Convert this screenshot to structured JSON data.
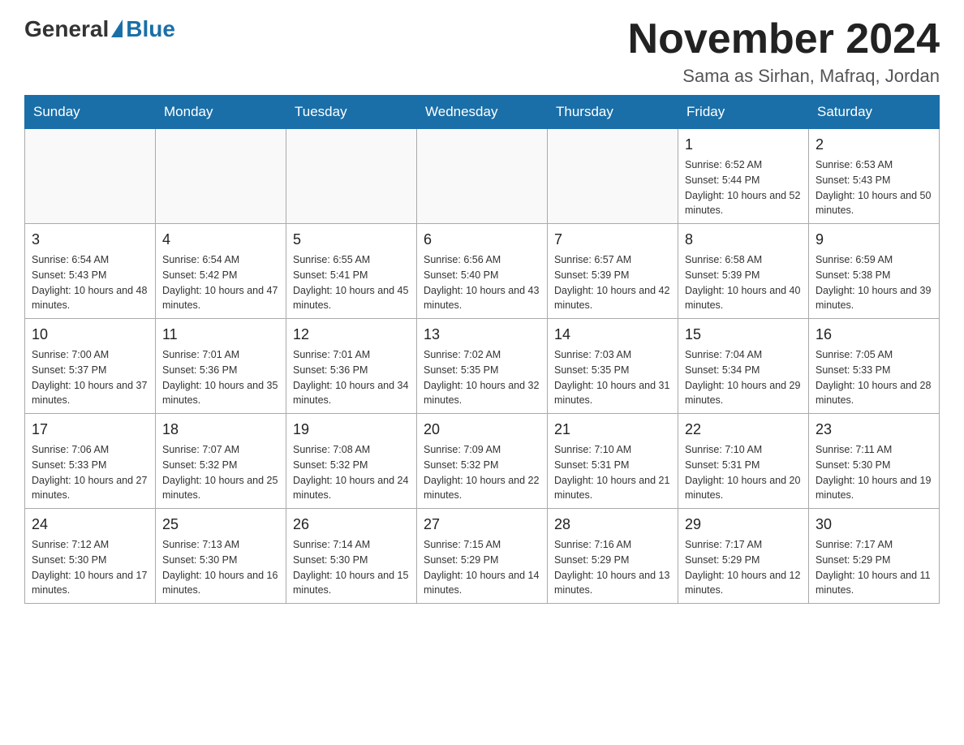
{
  "header": {
    "logo": {
      "general": "General",
      "blue": "Blue"
    },
    "title": "November 2024",
    "location": "Sama as Sirhan, Mafraq, Jordan"
  },
  "days_of_week": [
    "Sunday",
    "Monday",
    "Tuesday",
    "Wednesday",
    "Thursday",
    "Friday",
    "Saturday"
  ],
  "weeks": [
    [
      {
        "day": "",
        "sunrise": "",
        "sunset": "",
        "daylight": ""
      },
      {
        "day": "",
        "sunrise": "",
        "sunset": "",
        "daylight": ""
      },
      {
        "day": "",
        "sunrise": "",
        "sunset": "",
        "daylight": ""
      },
      {
        "day": "",
        "sunrise": "",
        "sunset": "",
        "daylight": ""
      },
      {
        "day": "",
        "sunrise": "",
        "sunset": "",
        "daylight": ""
      },
      {
        "day": "1",
        "sunrise": "Sunrise: 6:52 AM",
        "sunset": "Sunset: 5:44 PM",
        "daylight": "Daylight: 10 hours and 52 minutes."
      },
      {
        "day": "2",
        "sunrise": "Sunrise: 6:53 AM",
        "sunset": "Sunset: 5:43 PM",
        "daylight": "Daylight: 10 hours and 50 minutes."
      }
    ],
    [
      {
        "day": "3",
        "sunrise": "Sunrise: 6:54 AM",
        "sunset": "Sunset: 5:43 PM",
        "daylight": "Daylight: 10 hours and 48 minutes."
      },
      {
        "day": "4",
        "sunrise": "Sunrise: 6:54 AM",
        "sunset": "Sunset: 5:42 PM",
        "daylight": "Daylight: 10 hours and 47 minutes."
      },
      {
        "day": "5",
        "sunrise": "Sunrise: 6:55 AM",
        "sunset": "Sunset: 5:41 PM",
        "daylight": "Daylight: 10 hours and 45 minutes."
      },
      {
        "day": "6",
        "sunrise": "Sunrise: 6:56 AM",
        "sunset": "Sunset: 5:40 PM",
        "daylight": "Daylight: 10 hours and 43 minutes."
      },
      {
        "day": "7",
        "sunrise": "Sunrise: 6:57 AM",
        "sunset": "Sunset: 5:39 PM",
        "daylight": "Daylight: 10 hours and 42 minutes."
      },
      {
        "day": "8",
        "sunrise": "Sunrise: 6:58 AM",
        "sunset": "Sunset: 5:39 PM",
        "daylight": "Daylight: 10 hours and 40 minutes."
      },
      {
        "day": "9",
        "sunrise": "Sunrise: 6:59 AM",
        "sunset": "Sunset: 5:38 PM",
        "daylight": "Daylight: 10 hours and 39 minutes."
      }
    ],
    [
      {
        "day": "10",
        "sunrise": "Sunrise: 7:00 AM",
        "sunset": "Sunset: 5:37 PM",
        "daylight": "Daylight: 10 hours and 37 minutes."
      },
      {
        "day": "11",
        "sunrise": "Sunrise: 7:01 AM",
        "sunset": "Sunset: 5:36 PM",
        "daylight": "Daylight: 10 hours and 35 minutes."
      },
      {
        "day": "12",
        "sunrise": "Sunrise: 7:01 AM",
        "sunset": "Sunset: 5:36 PM",
        "daylight": "Daylight: 10 hours and 34 minutes."
      },
      {
        "day": "13",
        "sunrise": "Sunrise: 7:02 AM",
        "sunset": "Sunset: 5:35 PM",
        "daylight": "Daylight: 10 hours and 32 minutes."
      },
      {
        "day": "14",
        "sunrise": "Sunrise: 7:03 AM",
        "sunset": "Sunset: 5:35 PM",
        "daylight": "Daylight: 10 hours and 31 minutes."
      },
      {
        "day": "15",
        "sunrise": "Sunrise: 7:04 AM",
        "sunset": "Sunset: 5:34 PM",
        "daylight": "Daylight: 10 hours and 29 minutes."
      },
      {
        "day": "16",
        "sunrise": "Sunrise: 7:05 AM",
        "sunset": "Sunset: 5:33 PM",
        "daylight": "Daylight: 10 hours and 28 minutes."
      }
    ],
    [
      {
        "day": "17",
        "sunrise": "Sunrise: 7:06 AM",
        "sunset": "Sunset: 5:33 PM",
        "daylight": "Daylight: 10 hours and 27 minutes."
      },
      {
        "day": "18",
        "sunrise": "Sunrise: 7:07 AM",
        "sunset": "Sunset: 5:32 PM",
        "daylight": "Daylight: 10 hours and 25 minutes."
      },
      {
        "day": "19",
        "sunrise": "Sunrise: 7:08 AM",
        "sunset": "Sunset: 5:32 PM",
        "daylight": "Daylight: 10 hours and 24 minutes."
      },
      {
        "day": "20",
        "sunrise": "Sunrise: 7:09 AM",
        "sunset": "Sunset: 5:32 PM",
        "daylight": "Daylight: 10 hours and 22 minutes."
      },
      {
        "day": "21",
        "sunrise": "Sunrise: 7:10 AM",
        "sunset": "Sunset: 5:31 PM",
        "daylight": "Daylight: 10 hours and 21 minutes."
      },
      {
        "day": "22",
        "sunrise": "Sunrise: 7:10 AM",
        "sunset": "Sunset: 5:31 PM",
        "daylight": "Daylight: 10 hours and 20 minutes."
      },
      {
        "day": "23",
        "sunrise": "Sunrise: 7:11 AM",
        "sunset": "Sunset: 5:30 PM",
        "daylight": "Daylight: 10 hours and 19 minutes."
      }
    ],
    [
      {
        "day": "24",
        "sunrise": "Sunrise: 7:12 AM",
        "sunset": "Sunset: 5:30 PM",
        "daylight": "Daylight: 10 hours and 17 minutes."
      },
      {
        "day": "25",
        "sunrise": "Sunrise: 7:13 AM",
        "sunset": "Sunset: 5:30 PM",
        "daylight": "Daylight: 10 hours and 16 minutes."
      },
      {
        "day": "26",
        "sunrise": "Sunrise: 7:14 AM",
        "sunset": "Sunset: 5:30 PM",
        "daylight": "Daylight: 10 hours and 15 minutes."
      },
      {
        "day": "27",
        "sunrise": "Sunrise: 7:15 AM",
        "sunset": "Sunset: 5:29 PM",
        "daylight": "Daylight: 10 hours and 14 minutes."
      },
      {
        "day": "28",
        "sunrise": "Sunrise: 7:16 AM",
        "sunset": "Sunset: 5:29 PM",
        "daylight": "Daylight: 10 hours and 13 minutes."
      },
      {
        "day": "29",
        "sunrise": "Sunrise: 7:17 AM",
        "sunset": "Sunset: 5:29 PM",
        "daylight": "Daylight: 10 hours and 12 minutes."
      },
      {
        "day": "30",
        "sunrise": "Sunrise: 7:17 AM",
        "sunset": "Sunset: 5:29 PM",
        "daylight": "Daylight: 10 hours and 11 minutes."
      }
    ]
  ]
}
